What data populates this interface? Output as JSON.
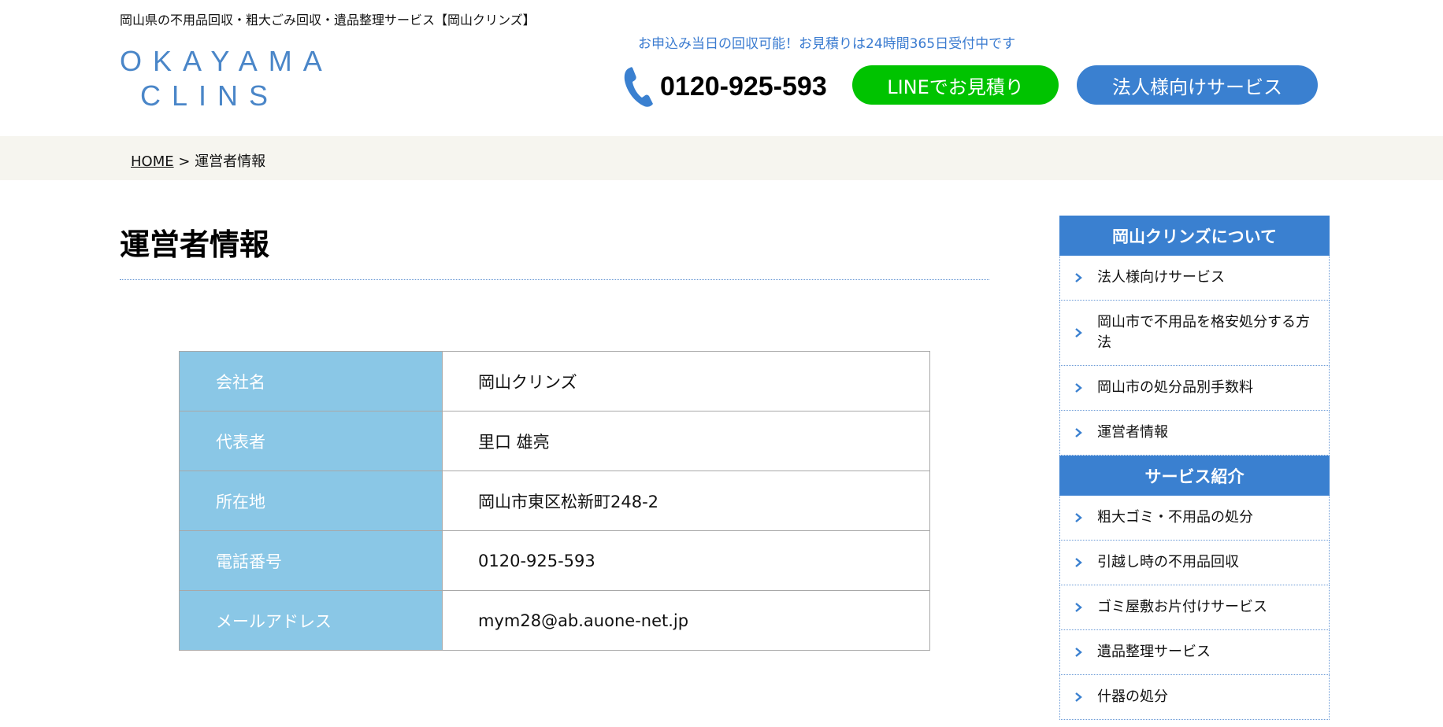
{
  "header": {
    "tagline": "岡山県の不用品回収・粗大ごみ回収・遺品整理サービス【岡山クリンズ】",
    "logo_line1": "OKAYAMA",
    "logo_line2": "CLINS",
    "notice": "お申込み当日の回収可能！お見積りは24時間365日受付中です",
    "phone": "0120-925-593",
    "line_button": "LINEでお見積り",
    "corp_button": "法人様向けサービス"
  },
  "breadcrumb": {
    "home": "HOME",
    "sep": " > ",
    "current": "運営者情報"
  },
  "main": {
    "title": "運営者情報",
    "table": [
      {
        "label": "会社名",
        "value": "岡山クリンズ"
      },
      {
        "label": "代表者",
        "value": "里口 雄亮"
      },
      {
        "label": "所在地",
        "value": "岡山市東区松新町248-2"
      },
      {
        "label": "電話番号",
        "value": "0120-925-593"
      },
      {
        "label": "メールアドレス",
        "value": "mym28@ab.auone-net.jp"
      }
    ]
  },
  "sidebar": {
    "section1_title": "岡山クリンズについて",
    "section1_items": [
      {
        "label": "法人様向けサービス"
      },
      {
        "label": "岡山市で不用品を格安処分する方法"
      },
      {
        "label": "岡山市の処分品別手数料"
      },
      {
        "label": "運営者情報"
      }
    ],
    "section2_title": "サービス紹介",
    "section2_items": [
      {
        "label": "粗大ゴミ・不用品の処分"
      },
      {
        "label": "引越し時の不用品回収"
      },
      {
        "label": "ゴミ屋敷お片付けサービス"
      },
      {
        "label": "遺品整理サービス"
      },
      {
        "label": "什器の処分"
      }
    ]
  },
  "colors": {
    "brand_blue": "#3a80d0",
    "line_green": "#00c300",
    "table_key_bg": "#8ac7e6",
    "breadcrumb_bg": "#f6f5ef"
  }
}
